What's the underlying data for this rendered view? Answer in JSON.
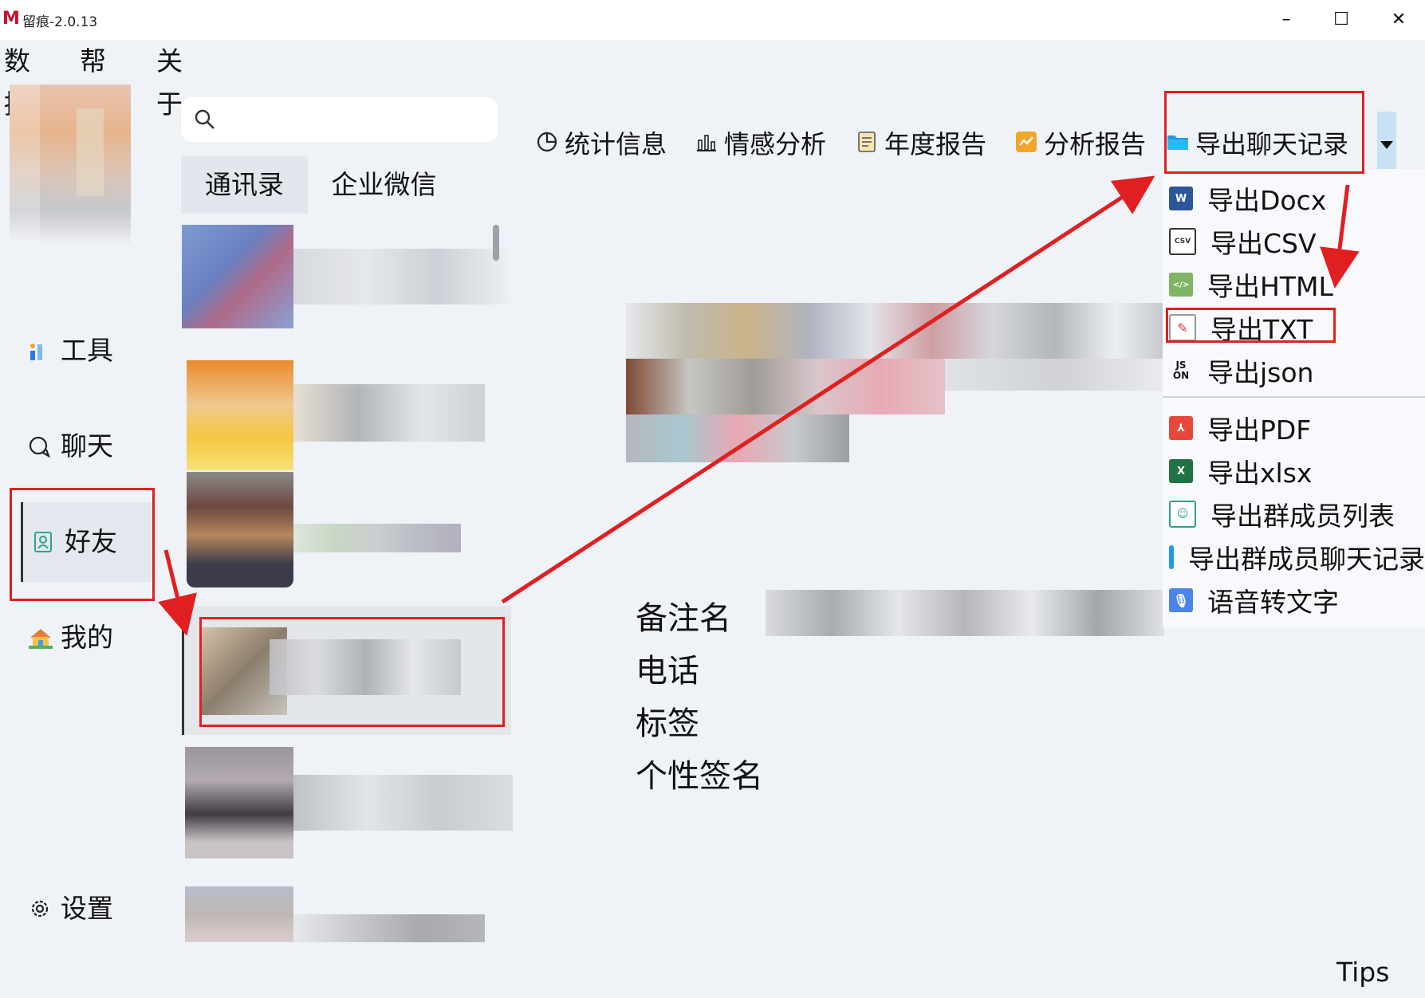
{
  "window": {
    "title": "留痕-2.0.13",
    "logo": "M",
    "minimize": "–",
    "maximize": "☐",
    "close": "✕"
  },
  "menubar": [
    "数据",
    "帮助",
    "关于"
  ],
  "nav": {
    "tools": "工具",
    "chat": "聊天",
    "friends": "好友",
    "me": "我的",
    "settings": "设置"
  },
  "search": {
    "placeholder": ""
  },
  "tabs": [
    "通讯录",
    "企业微信"
  ],
  "toolbar": {
    "stats": "统计信息",
    "sentiment": "情感分析",
    "annual": "年度报告",
    "analysis": "分析报告",
    "export": "导出聊天记录"
  },
  "export_menu": [
    {
      "label": "导出Docx",
      "icon": "word-icon"
    },
    {
      "label": "导出CSV",
      "icon": "csv-icon"
    },
    {
      "label": "导出HTML",
      "icon": "html-icon"
    },
    {
      "label": "导出TXT",
      "icon": "txt-icon"
    },
    {
      "label": "导出json",
      "icon": "json-icon"
    },
    {
      "label": "导出PDF",
      "icon": "pdf-icon"
    },
    {
      "label": "导出xlsx",
      "icon": "excel-icon"
    },
    {
      "label": "导出群成员列表",
      "icon": "contacts-icon"
    },
    {
      "label": "导出群成员聊天记录",
      "icon": "folder-icon"
    },
    {
      "label": "语音转文字",
      "icon": "voice-icon"
    }
  ],
  "detail": {
    "remark": "备注名",
    "phone": "电话",
    "tags": "标签",
    "signature": "个性签名"
  },
  "footer": {
    "tips": "Tips"
  },
  "colors": {
    "accent": "#1e88e5",
    "annotation": "#e02020",
    "selected_nav": "#e4e8ee"
  }
}
